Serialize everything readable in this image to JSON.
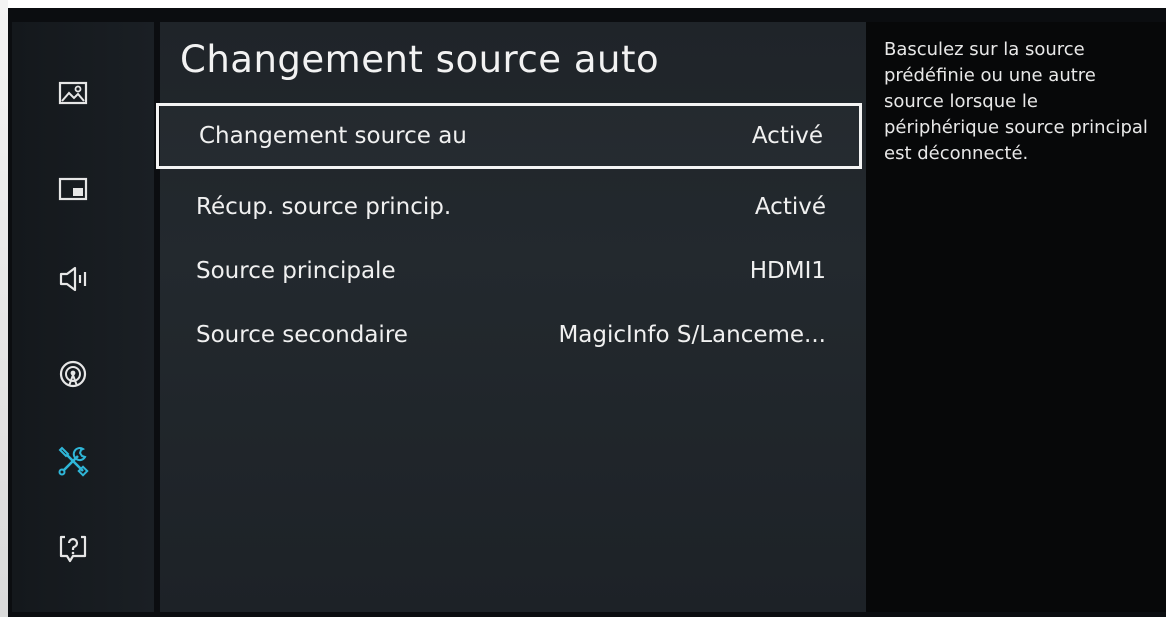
{
  "menu": {
    "title": "Changement source auto",
    "items": [
      {
        "label": "Changement source au",
        "value": "Activé"
      },
      {
        "label": "Récup. source princip.",
        "value": "Activé"
      },
      {
        "label": "Source principale",
        "value": "HDMI1"
      },
      {
        "label": "Source secondaire",
        "value": "MagicInfo S/Lanceme..."
      }
    ]
  },
  "help": {
    "text": "Basculez sur la source prédéfinie ou une autre source lorsque le périphérique source principal est déconnecté."
  },
  "sidebar": {
    "icons": [
      "picture-icon",
      "screen-layout-icon",
      "sound-icon",
      "network-icon",
      "tools-icon",
      "support-icon"
    ],
    "active_icon": "tools-icon"
  },
  "colors": {
    "accent": "#2fb6d8",
    "text": "#f0f0f0",
    "background": "#1f2429"
  }
}
